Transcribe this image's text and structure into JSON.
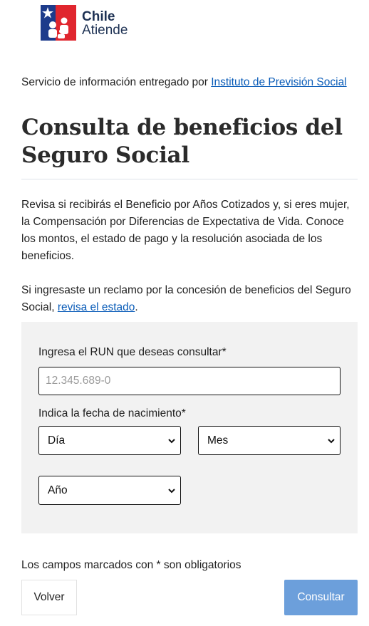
{
  "brand": {
    "line1": "Chile",
    "line2": "Atiende",
    "colors": {
      "blue": "#1d3b8b",
      "red": "#e0262e",
      "text": "#1d3153"
    }
  },
  "provider": {
    "prefix": "Servicio de información entregado por ",
    "link": "Instituto de Previsión Social"
  },
  "page_title": "Consulta de beneficios del Seguro Social",
  "intro": "Revisa si recibirás el Beneficio por Años Cotizados y, si eres mujer, la Compensación por Diferencias de Expectativa de Vida. Conoce los montos, el estado de pago y la resolución asociada de los beneficios.",
  "claim": {
    "prefix": "Si ingresaste un reclamo por la concesión de beneficios del Seguro Social, ",
    "link": "revisa el estado",
    "suffix": "."
  },
  "form": {
    "run_label": "Ingresa el RUN que deseas consultar*",
    "run_placeholder": "12.345.689-0",
    "run_value": "",
    "date_label": "Indica la fecha de nacimiento*",
    "day_select": "Día",
    "month_select": "Mes",
    "year_select": "Año"
  },
  "required_note": "Los campos marcados con * son obligatorios",
  "buttons": {
    "back": "Volver",
    "submit": "Consultar"
  },
  "colors": {
    "link": "#0a5cb8",
    "submit_bg": "#6c9fdb",
    "form_bg": "#f2f2f2"
  }
}
